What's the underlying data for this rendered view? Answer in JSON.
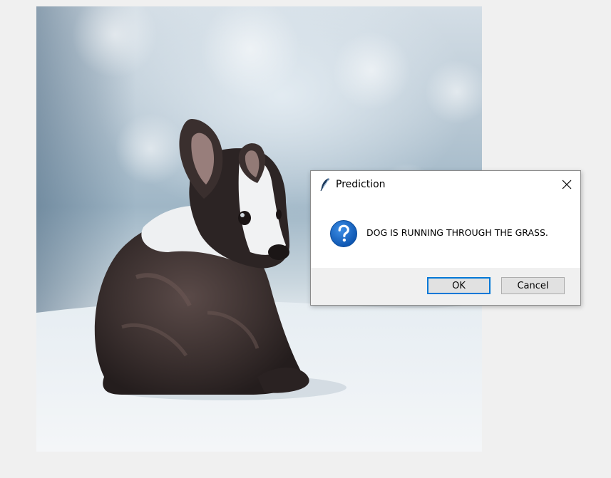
{
  "photo": {
    "subject": "dog-photo"
  },
  "dialog": {
    "title": "Prediction",
    "message": "DOG IS RUNNING THROUGH THE GRASS.",
    "ok_label": "OK",
    "cancel_label": "Cancel",
    "icon": "question-icon",
    "title_icon": "feather-icon",
    "accent_color": "#0078d7",
    "icon_color": "#1565c0"
  }
}
